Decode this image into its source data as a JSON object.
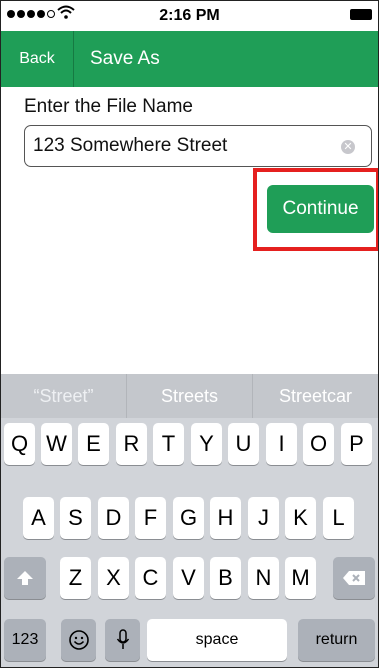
{
  "status_bar": {
    "time": "2:16 PM"
  },
  "nav": {
    "back_label": "Back",
    "title": "Save As"
  },
  "form": {
    "label": "Enter the File Name",
    "file_name_value": "123 Somewhere Street",
    "continue_label": "Continue"
  },
  "keyboard": {
    "predictions": [
      "“Street”",
      "Streets",
      "Streetcar"
    ],
    "row1": [
      "Q",
      "W",
      "E",
      "R",
      "T",
      "Y",
      "U",
      "I",
      "O",
      "P"
    ],
    "row2": [
      "A",
      "S",
      "D",
      "F",
      "G",
      "H",
      "J",
      "K",
      "L"
    ],
    "row3": [
      "Z",
      "X",
      "C",
      "V",
      "B",
      "N",
      "M"
    ],
    "numbers_label": "123",
    "space_label": "space",
    "return_label": "return"
  },
  "colors": {
    "brand_green": "#1f9e57",
    "highlight_red": "#e5201f"
  }
}
